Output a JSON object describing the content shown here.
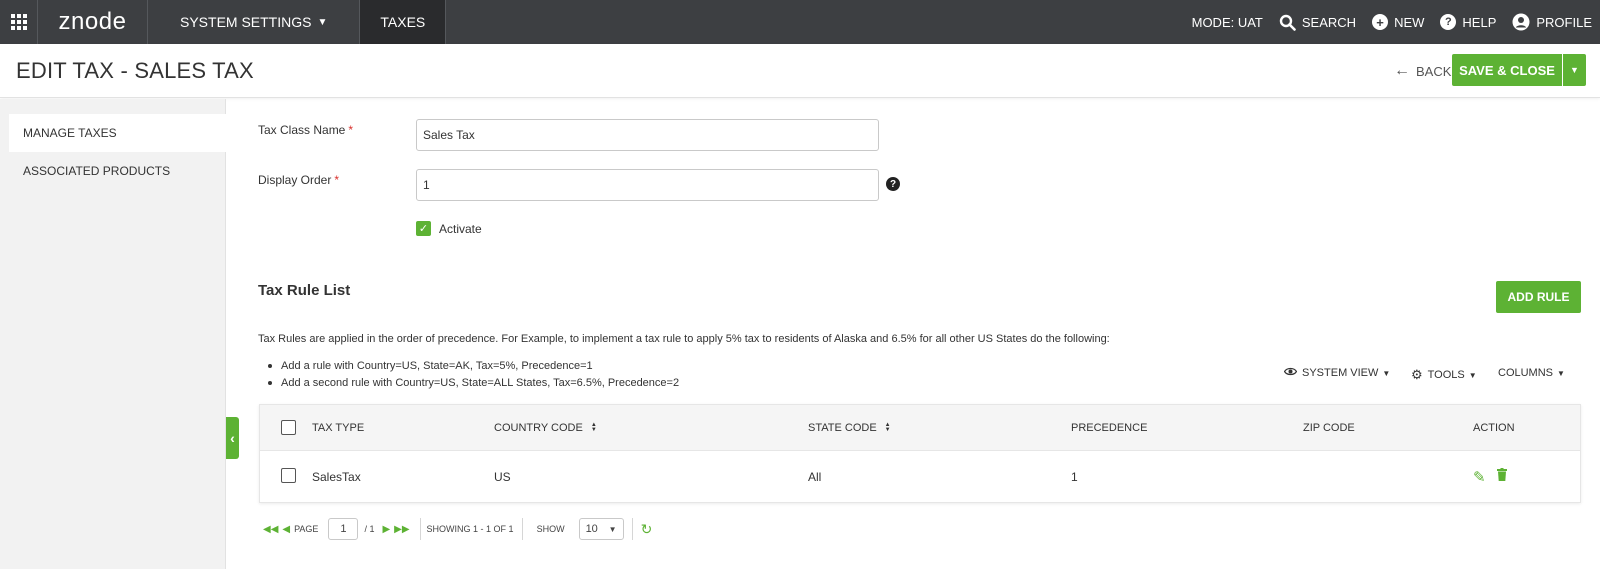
{
  "topbar": {
    "logo": "znode",
    "nav": [
      {
        "label": "SYSTEM SETTINGS",
        "has_dropdown": true
      },
      {
        "label": "TAXES",
        "active": true
      }
    ],
    "mode": "MODE: UAT",
    "links": {
      "search": "SEARCH",
      "new": "NEW",
      "help": "HELP",
      "profile": "PROFILE"
    }
  },
  "header": {
    "title": "EDIT TAX - SALES TAX",
    "back_label": "BACK",
    "save_label": "SAVE & CLOSE"
  },
  "sidebar": {
    "items": [
      {
        "label": "MANAGE TAXES",
        "active": true
      },
      {
        "label": "ASSOCIATED PRODUCTS",
        "active": false
      }
    ]
  },
  "form": {
    "tax_class_name_label": "Tax Class Name",
    "tax_class_name_value": "Sales Tax",
    "display_order_label": "Display Order",
    "display_order_value": "1",
    "required_marker": "*",
    "activate_label": "Activate",
    "activate_checked": true
  },
  "rules": {
    "section_title": "Tax Rule List",
    "add_rule_label": "ADD RULE",
    "description": "Tax Rules are applied in the order of precedence. For Example, to implement a tax rule to apply 5% tax to residents of Alaska and 6.5% for all other US States do the following:",
    "bullets": [
      "Add a rule with Country=US, State=AK, Tax=5%, Precedence=1",
      "Add a second rule with Country=US, State=ALL States, Tax=6.5%, Precedence=2"
    ],
    "tools": {
      "system_view": "SYSTEM VIEW",
      "tools": "TOOLS",
      "columns": "COLUMNS"
    }
  },
  "table": {
    "columns": [
      "TAX TYPE",
      "COUNTRY CODE",
      "STATE CODE",
      "PRECEDENCE",
      "ZIP CODE",
      "ACTION"
    ],
    "rows": [
      {
        "tax_type": "SalesTax",
        "country_code": "US",
        "state_code": "All",
        "precedence": "1",
        "zip_code": ""
      }
    ]
  },
  "pager": {
    "page_label": "PAGE",
    "page_value": "1",
    "page_total": "/ 1",
    "showing": "SHOWING 1 - 1 OF 1",
    "show_label": "SHOW",
    "show_value": "10"
  },
  "colors": {
    "accent": "#5db234",
    "topbar": "#3d3f42",
    "sidebar": "#f2f2f2"
  },
  "icons": [
    "apps-grid-icon",
    "search-icon",
    "plus-circle-icon",
    "question-circle-icon",
    "user-circle-icon",
    "arrow-left-icon",
    "chevron-down-icon",
    "question-icon",
    "check-icon",
    "eye-icon",
    "gear-icon",
    "sort-icon",
    "pencil-icon",
    "trash-icon",
    "first-page-icon",
    "prev-page-icon",
    "next-page-icon",
    "last-page-icon",
    "refresh-icon",
    "collapse-icon"
  ]
}
